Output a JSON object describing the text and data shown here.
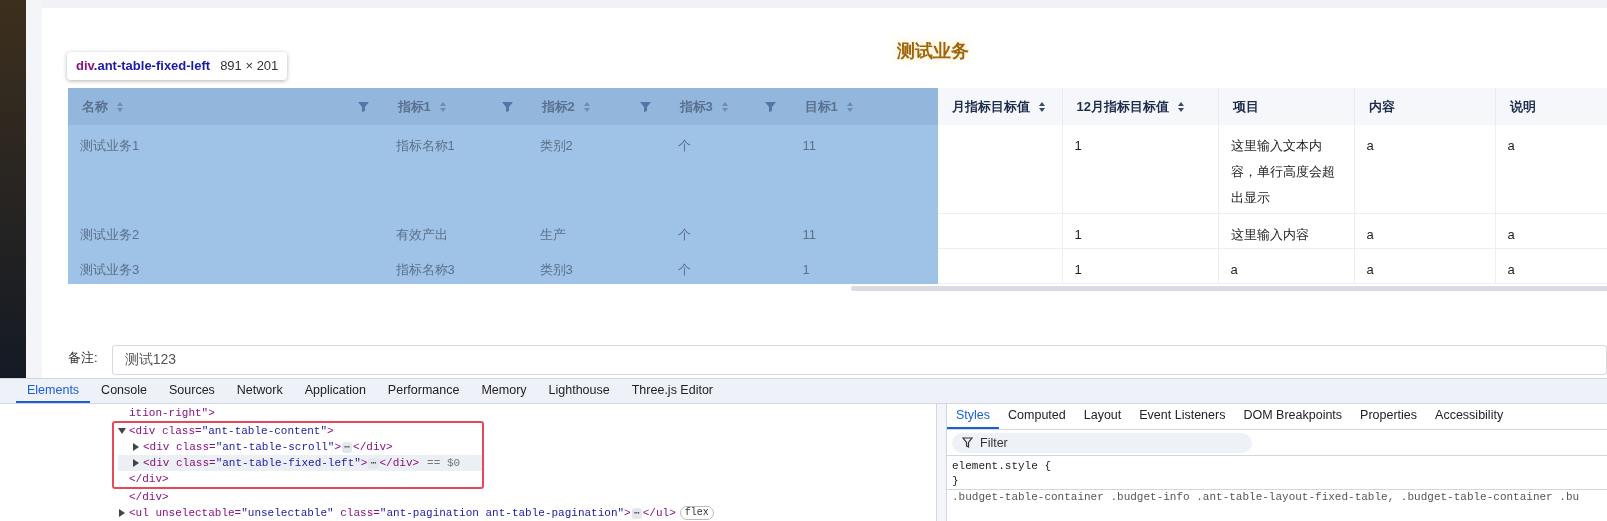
{
  "page": {
    "title": "测试业务"
  },
  "inspect_tooltip": {
    "tag": "div",
    "class_name": ".ant-table-fixed-left",
    "size": "891 × 201"
  },
  "table": {
    "columns": [
      {
        "label": "名称",
        "sortable": true,
        "filterable": true,
        "fixed": true
      },
      {
        "label": "指标1",
        "sortable": true,
        "filterable": true,
        "fixed": true
      },
      {
        "label": "指标2",
        "sortable": true,
        "filterable": true,
        "fixed": true
      },
      {
        "label": "指标3",
        "sortable": true,
        "filterable": true,
        "fixed": true
      },
      {
        "label": "目标1",
        "sortable": true,
        "filterable": false,
        "fixed": true
      },
      {
        "label": "月指标目标值",
        "sortable": true,
        "filterable": false,
        "fixed": false
      },
      {
        "label": "12月指标目标值",
        "sortable": true,
        "filterable": false,
        "fixed": false
      },
      {
        "label": "项目",
        "sortable": false,
        "filterable": false,
        "fixed": false
      },
      {
        "label": "内容",
        "sortable": false,
        "filterable": false,
        "fixed": false
      },
      {
        "label": "说明",
        "sortable": false,
        "filterable": false,
        "fixed": false
      }
    ],
    "rows": [
      [
        "测试业务1",
        "指标名称1",
        "类别2",
        "个",
        "11",
        "",
        "1",
        "这里输入文本内容，单行高度会超出显示",
        "a",
        "a"
      ],
      [
        "测试业务2",
        "有效产出",
        "生产",
        "个",
        "11",
        "",
        "1",
        "这里输入内容",
        "a",
        "a"
      ],
      [
        "测试业务3",
        "指标名称3",
        "类别3",
        "个",
        "1",
        "",
        "1",
        "a",
        "a",
        "a"
      ]
    ]
  },
  "remark": {
    "label": "备注:",
    "value": "测试123"
  },
  "devtools": {
    "tabs": [
      {
        "label": "Elements",
        "selected": true
      },
      {
        "label": "Console",
        "selected": false
      },
      {
        "label": "Sources",
        "selected": false
      },
      {
        "label": "Network",
        "selected": false
      },
      {
        "label": "Application",
        "selected": false
      },
      {
        "label": "Performance",
        "selected": false
      },
      {
        "label": "Memory",
        "selected": false
      },
      {
        "label": "Lighthouse",
        "selected": false
      },
      {
        "label": "Three.js Editor",
        "selected": false
      }
    ],
    "tree": [
      {
        "text": "ition-right\">"
      },
      {
        "text": "<div class=\"ant-table-content\">",
        "expanded": true,
        "outlined": true,
        "closing": "</div>",
        "children": [
          {
            "text": "<div class=\"ant-table-scroll\">",
            "expanded": false,
            "ellipsis": "⋯",
            "after": "</div>",
            "selected": false
          },
          {
            "text": "<div class=\"ant-table-fixed-left\">",
            "expanded": false,
            "ellipsis": "⋯",
            "after": "</div>",
            "suffix": "== $0",
            "selected": true
          }
        ]
      },
      {
        "text": "</div>"
      },
      {
        "text": "<ul unselectable=\"unselectable\" class=\"ant-pagination ant-table-pagination\">",
        "expanded": false,
        "ellipsis": "⋯",
        "after": "</ul>",
        "badge": "flex"
      }
    ],
    "side_tabs": [
      {
        "label": "Styles",
        "selected": true
      },
      {
        "label": "Computed",
        "selected": false
      },
      {
        "label": "Layout",
        "selected": false
      },
      {
        "label": "Event Listeners",
        "selected": false
      },
      {
        "label": "DOM Breakpoints",
        "selected": false
      },
      {
        "label": "Properties",
        "selected": false
      },
      {
        "label": "Accessibility",
        "selected": false
      }
    ],
    "filter": {
      "placeholder": "Filter"
    },
    "styles": [
      "element.style {",
      "}"
    ],
    "rule_selector": ".budget-table-container .budget-info .ant-table-layout-fixed-table, .budget-table-container .bu"
  }
}
